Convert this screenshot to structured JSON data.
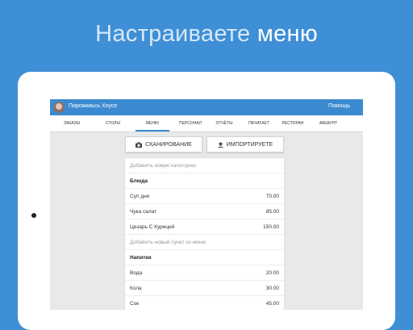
{
  "headline": {
    "part1": "Настраиваете",
    "part2": "меню"
  },
  "app": {
    "title": "Пирожкиьсь Хоусе",
    "help": "Помощь"
  },
  "tabs": [
    {
      "label": "ЗАКАЗЫ"
    },
    {
      "label": "СТОЛЫ"
    },
    {
      "label": "МЕНЮ",
      "active": true
    },
    {
      "label": "ПЕРСОНАЛ"
    },
    {
      "label": "ОТЧЁТЫ"
    },
    {
      "label": "ПЕЧАТАЕТ"
    },
    {
      "label": "РЕСТОРАН"
    },
    {
      "label": "АККАУНТ"
    }
  ],
  "buttons": {
    "scan": "СКАНИРОВАНИЕ",
    "import": "ИМПОРТИРУЕТЕ"
  },
  "menu": {
    "add_category": "Добавить новую категорию",
    "categories": [
      {
        "name": "Блюда",
        "items": [
          {
            "name": "Суп дня",
            "price": "70.00"
          },
          {
            "name": "Чука салат",
            "price": "85.00"
          },
          {
            "name": "Цезарь С Курицей",
            "price": "150.00"
          }
        ],
        "add_item": "Добавить новый пункт из меню"
      },
      {
        "name": "Напитки",
        "items": [
          {
            "name": "Вода",
            "price": "20.00"
          },
          {
            "name": "Кола",
            "price": "30.00"
          },
          {
            "name": "Сок",
            "price": "45.00"
          }
        ]
      }
    ]
  },
  "colors": {
    "background": "#3f8fd6",
    "appbar": "#3b8ad0",
    "accent": "#3b8ad0"
  },
  "icons": {
    "scan": "camera-icon",
    "import": "upload-icon"
  }
}
